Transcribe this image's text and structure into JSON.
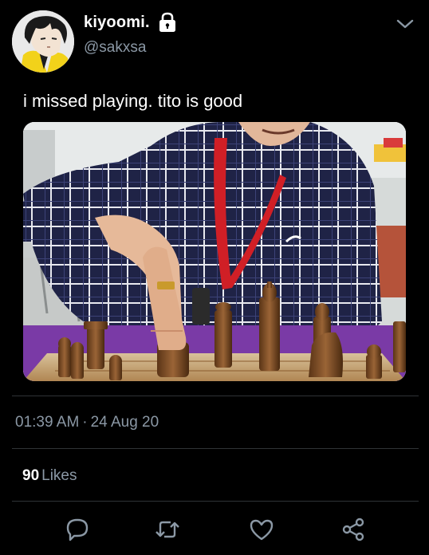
{
  "user": {
    "display_name": "kiyoomi.",
    "handle": "@sakxsa",
    "protected": true
  },
  "tweet": {
    "text": "i missed playing. tito is good",
    "time": "01:39 AM",
    "date": "24 Aug 20",
    "separator": "·"
  },
  "stats": {
    "likes_count": "90",
    "likes_label": "Likes"
  },
  "icons": {
    "lock": "lock-icon",
    "chevron": "chevron-down-icon",
    "reply": "reply-icon",
    "retweet": "retweet-icon",
    "like": "heart-icon",
    "share": "share-icon"
  },
  "colors": {
    "background": "#000000",
    "text": "#ffffff",
    "secondary": "#8b98a5",
    "divider": "#2f3336"
  }
}
